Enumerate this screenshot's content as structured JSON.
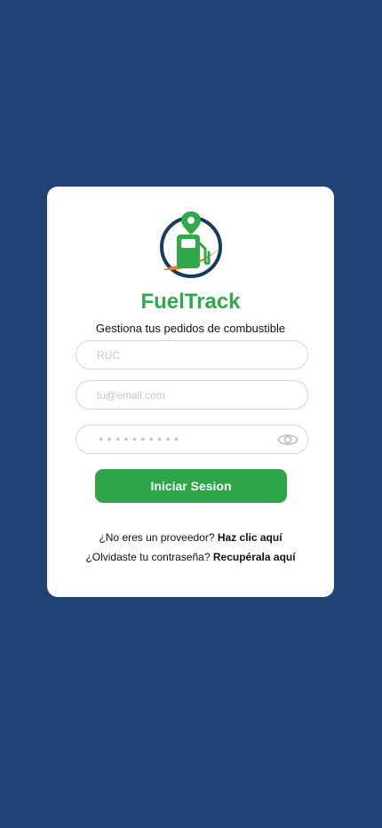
{
  "app": {
    "name": "FuelTrack",
    "tagline": "Gestiona tus pedidos de combustible"
  },
  "form": {
    "ruc_placeholder": "RUC",
    "email_placeholder": "tu@email.com",
    "password_mask": "●●●●●●●●●●",
    "password_toggle_icon": "eye-icon",
    "submit_label": "Iniciar Sesion"
  },
  "links": {
    "provider_prompt": "¿No eres un proveedor?",
    "provider_link": "Haz clic aquí",
    "forgot_prompt": "¿Olvidaste tu contraseña?",
    "forgot_link": "Recupérala aquí"
  },
  "colors": {
    "background": "#1e4374",
    "card": "#ffffff",
    "brand_green": "#2eaa4a",
    "logo_navy": "#173a5e",
    "logo_orange": "#f07f22"
  }
}
